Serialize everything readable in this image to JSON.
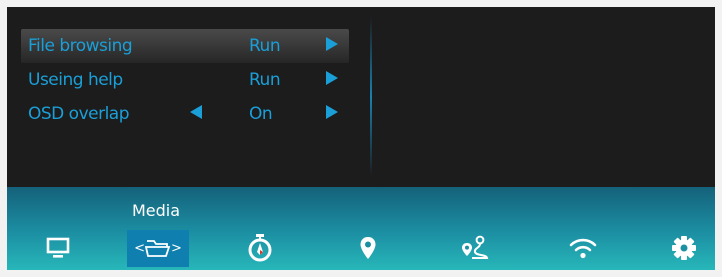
{
  "menu": {
    "items": [
      {
        "label": "File browsing",
        "value": "Run",
        "has_left_arrow": false,
        "selected": true
      },
      {
        "label": "Useing help",
        "value": "Run",
        "has_left_arrow": false,
        "selected": false
      },
      {
        "label": "OSD overlap",
        "value": "On",
        "has_left_arrow": true,
        "selected": false
      }
    ]
  },
  "taskbar": {
    "active_label": "Media",
    "tabs": [
      {
        "id": "display",
        "icon": "monitor-icon"
      },
      {
        "id": "media",
        "icon": "folder-icon",
        "active": true
      },
      {
        "id": "timer",
        "icon": "stopwatch-icon"
      },
      {
        "id": "location",
        "icon": "map-pin-icon"
      },
      {
        "id": "route",
        "icon": "route-icon"
      },
      {
        "id": "wifi",
        "icon": "wifi-icon"
      },
      {
        "id": "settings",
        "icon": "gear-icon"
      }
    ]
  },
  "colors": {
    "menu_text": "#1a9fd8",
    "background": "#1c1c1c",
    "taskbar_top": "#14617a",
    "taskbar_bottom": "#27b7b9",
    "active_tile": "#0f7fb0"
  }
}
